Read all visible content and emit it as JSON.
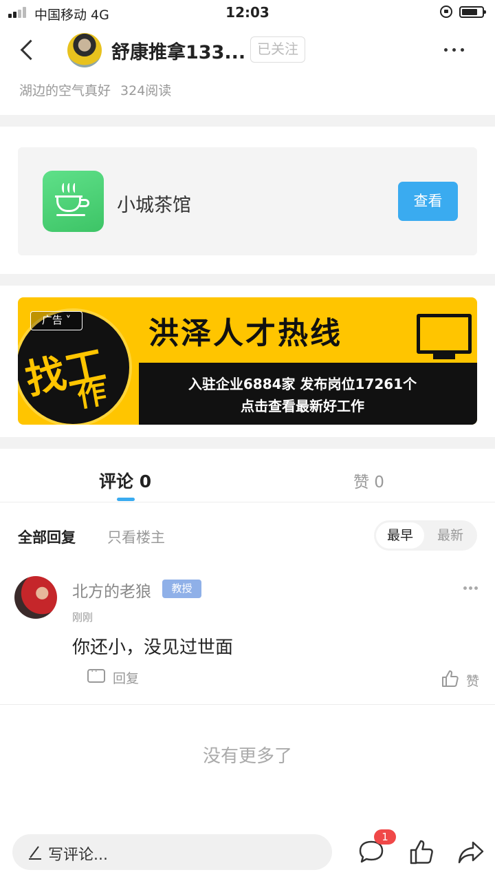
{
  "status": {
    "carrier": "中国移动  4G",
    "time": "12:03"
  },
  "header": {
    "author": "舒康推拿133...",
    "follow_label": "已关注"
  },
  "post": {
    "title": "湖边的空气真好",
    "reads": "324阅读"
  },
  "app_card": {
    "name": "小城茶馆",
    "button": "查看",
    "accent": "#3aabf0"
  },
  "ad_banner": {
    "tag": "广告",
    "circle_text_1": "找工",
    "circle_text_2": "作",
    "title": "洪泽人才热线",
    "line1": "入驻企业6884家  发布岗位17261个",
    "line2": "点击查看最新好工作",
    "bg_color": "#ffc500"
  },
  "tabs": {
    "comments": "评论 0",
    "likes": "赞 0"
  },
  "filters": {
    "all": "全部回复",
    "owner_only": "只看楼主",
    "sort_earliest": "最早",
    "sort_newest": "最新"
  },
  "comments": [
    {
      "name": "北方的老狼",
      "badge": "教授",
      "time": "刚刚",
      "text": "你还小，没见过世面",
      "reply_label": "回复",
      "like_label": "赞"
    }
  ],
  "end_text": "没有更多了",
  "bottom_bar": {
    "placeholder": "写评论...",
    "comment_count": "1"
  }
}
